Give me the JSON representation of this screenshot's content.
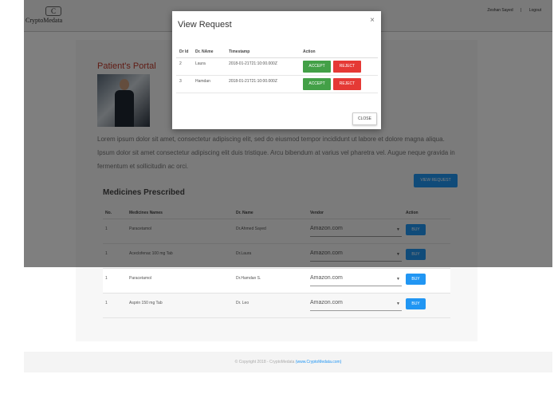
{
  "header": {
    "logo_mark": "C",
    "logo_text": "CryptoMedata",
    "user_name": "Zeshan Sayed",
    "separator": "|",
    "logout_label": "Logout"
  },
  "portal": {
    "title": "Patient's Portal",
    "description": "Lorem ipsum dolor sit amet, consectetur adipiscing elit, sed do eiusmod tempor incididunt ut labore et dolore magna aliqua. Ipsum dolor sit amet consectetur adipiscing elit duis tristique. Arcu bibendum at varius vel pharetra vel. Augue neque gravida in fermentum et sollicitudin ac orci.",
    "view_request_label": "VIEW REQUEST"
  },
  "medicines": {
    "title": "Medicines Prescribed",
    "columns": [
      "No.",
      "Medicines Names",
      "Dr. Name",
      "Vendor",
      "Action"
    ],
    "rows": [
      {
        "no": "1",
        "name": "Paracetamol",
        "doctor": "Dr.Ahmed Sayed",
        "vendor": "Amazon.com",
        "action": "BUY"
      },
      {
        "no": "1",
        "name": "Aceclofenac 100 mg Tab",
        "doctor": "Dr.Laura",
        "vendor": "Amazon.com",
        "action": "BUY"
      },
      {
        "no": "1",
        "name": "Paracetamol",
        "doctor": "Dr.Hamdan S.",
        "vendor": "Amazon.com",
        "action": "BUY"
      },
      {
        "no": "1",
        "name": "Asprin 150 mg Tab",
        "doctor": "Dr. Leo",
        "vendor": "Amazon.com",
        "action": "BUY"
      }
    ]
  },
  "footer": {
    "text": "© Copyright 2018 - CryptoMedata",
    "link": "(www.CryptoMedata.com)"
  },
  "modal": {
    "title": "View Request",
    "close_icon": "×",
    "columns": [
      "Dr Id",
      "Dr. NAme",
      "Timestamp",
      "Action"
    ],
    "rows": [
      {
        "id": "2",
        "name": "Laura",
        "timestamp": "2018-01-21T21:10:00.000Z",
        "accept": "ACCEPT",
        "reject": "REJECT"
      },
      {
        "id": "3",
        "name": "Hamdan",
        "timestamp": "2018-01-21T21:10:00.000Z",
        "accept": "ACCEPT",
        "reject": "REJECT"
      }
    ],
    "close_label": "CLOSE"
  },
  "colors": {
    "accent": "#2196f3",
    "accept": "#43a047",
    "reject": "#e53935",
    "portal_title": "#c0392b"
  }
}
